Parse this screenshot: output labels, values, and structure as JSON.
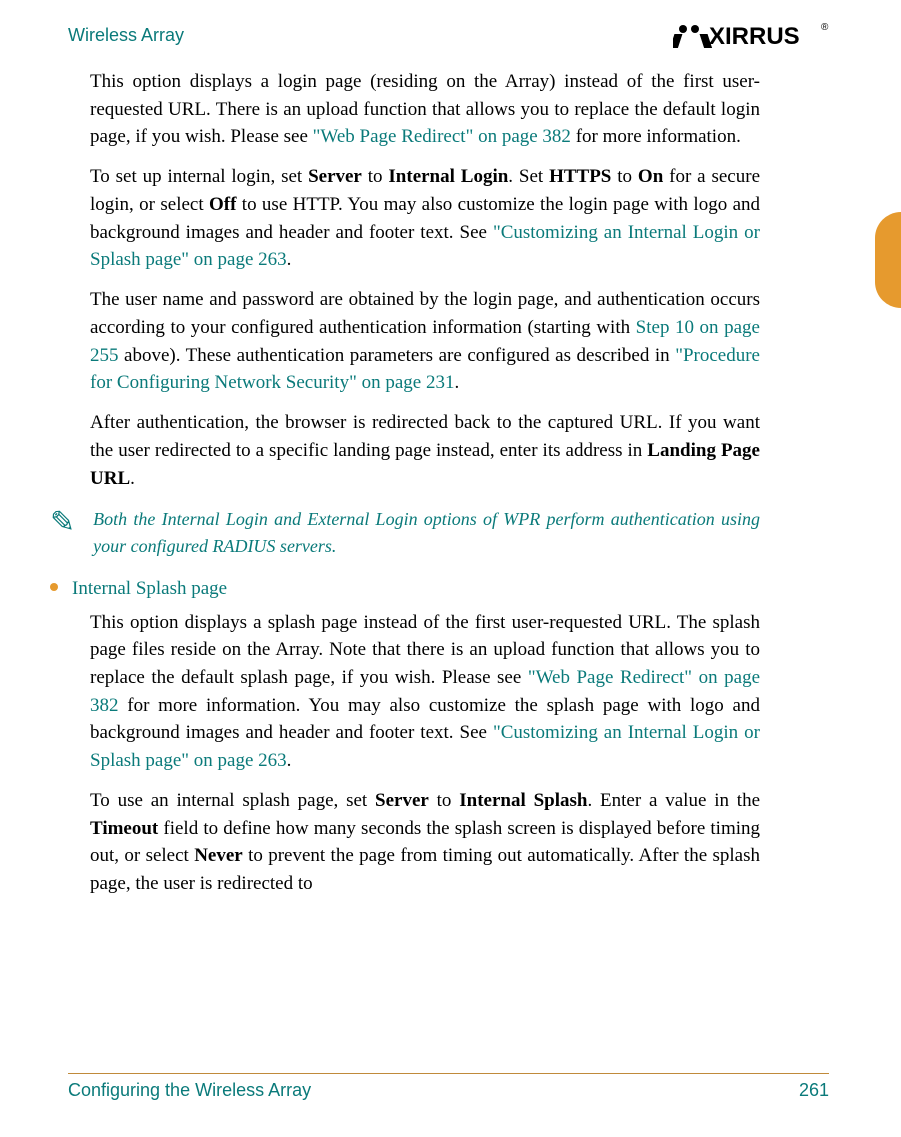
{
  "header": {
    "title": "Wireless Array",
    "logo_text": "XIRRUS",
    "logo_tm": "®"
  },
  "body": {
    "p1a": "This option displays a login page (residing on the Array) instead of the first user-requested URL. There is an upload function that allows you to replace the default login page, if you wish. Please see ",
    "p1_link": "\"Web Page Redirect\" on page 382",
    "p1b": " for more information.",
    "p2a": "To set up internal login, set ",
    "p2_b1": "Server",
    "p2b": " to ",
    "p2_b2": "Internal Login",
    "p2c": ". Set ",
    "p2_b3": "HTTPS",
    "p2d": " to ",
    "p2_b4": "On",
    "p2e": " for a secure login, or select ",
    "p2_b5": "Off",
    "p2f": " to use HTTP. You may also customize the login page with logo and background images and header and footer text. See ",
    "p2_link": "\"Customizing an Internal Login or Splash page\" on page 263",
    "p2g": ".",
    "p3a": "The user name and password are obtained by the login page, and authentication occurs according to your configured authentication information (starting with ",
    "p3_link1": "Step 10 on page 255",
    "p3b": " above). These authentication parameters are configured as described in ",
    "p3_link2": "\"Procedure for Configuring Network Security\" on page 231",
    "p3c": ".",
    "p4a": "After authentication, the browser is redirected back to the captured URL. If you want the user redirected to a specific landing page instead, enter its address in ",
    "p4_b1": "Landing Page URL",
    "p4b": ".",
    "note_icon": "✎",
    "note": "Both the Internal Login and External Login options of WPR perform authentication using your configured RADIUS servers.",
    "bullet_head": "Internal Splash page",
    "p5a": "This option displays a splash page instead of the first user-requested URL. The splash page files reside on the Array. Note that there is an upload function that allows you to replace the default splash page, if you wish. Please see ",
    "p5_link1": "\"Web Page Redirect\" on page 382",
    "p5b": " for more information. You may also customize the splash page with logo and background images and header and footer text. See ",
    "p5_link2": "\"Customizing an Internal Login or Splash page\" on page 263",
    "p5c": ".",
    "p6a": "To use an internal splash page, set ",
    "p6_b1": "Server",
    "p6b": " to ",
    "p6_b2": "Internal Splash",
    "p6c": ". Enter a value in the ",
    "p6_b3": "Timeout",
    "p6d": " field to define how many seconds the splash screen is displayed before timing out, or select ",
    "p6_b4": "Never",
    "p6e": " to prevent the page from timing out automatically. After the splash page, the user is redirected to"
  },
  "footer": {
    "left": "Configuring the Wireless Array",
    "right": "261"
  }
}
